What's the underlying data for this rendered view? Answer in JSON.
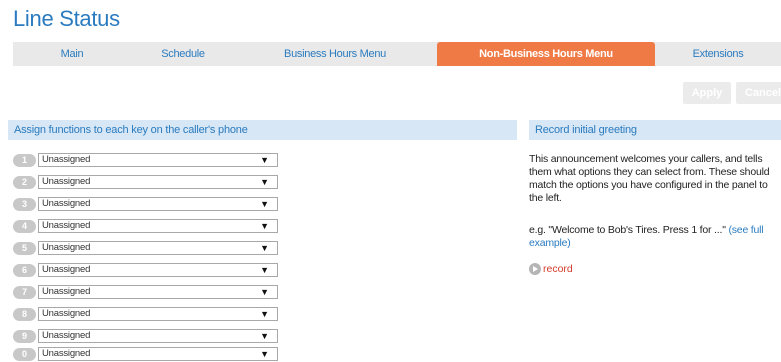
{
  "page": {
    "title": "Line Status"
  },
  "tabs": [
    {
      "label": "Main"
    },
    {
      "label": "Schedule"
    },
    {
      "label": "Business Hours Menu"
    },
    {
      "label": "Non-Business Hours Menu",
      "active": true
    },
    {
      "label": "Extensions"
    }
  ],
  "actions": {
    "apply_label": "Apply",
    "cancel_label": "Cancel"
  },
  "keys_panel": {
    "header": "Assign functions to each key on the caller's phone",
    "rows": [
      {
        "key": "1",
        "value": "Unassigned"
      },
      {
        "key": "2",
        "value": "Unassigned"
      },
      {
        "key": "3",
        "value": "Unassigned"
      },
      {
        "key": "4",
        "value": "Unassigned"
      },
      {
        "key": "5",
        "value": "Unassigned"
      },
      {
        "key": "6",
        "value": "Unassigned"
      },
      {
        "key": "7",
        "value": "Unassigned"
      },
      {
        "key": "8",
        "value": "Unassigned"
      },
      {
        "key": "9",
        "value": "Unassigned"
      },
      {
        "key": "0",
        "value": "Unassigned"
      }
    ]
  },
  "greeting_panel": {
    "header": "Record initial greeting",
    "description": "This announcement welcomes your callers, and tells them what options they can select from. These should match the options you have configured in the panel to the left.",
    "example_text": "e.g. \"Welcome to Bob's Tires. Press 1 for ...\"",
    "example_link": "(see full example)",
    "record_label": "record"
  },
  "colors": {
    "title": "#2a7bbf",
    "active_tab": "#f07a46",
    "panel_header_bg": "#d7e7f5",
    "record_link": "#d43c2c"
  },
  "icons": {
    "key_select_arrow": "dropdown-arrow-icon",
    "record": "play-record-icon"
  }
}
